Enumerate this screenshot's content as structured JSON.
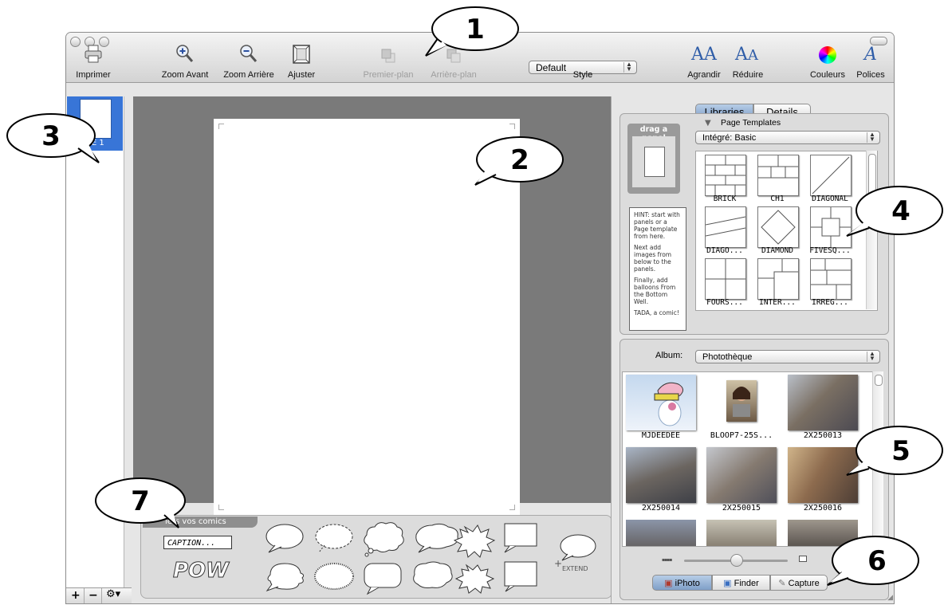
{
  "toolbar": {
    "print": "Imprimer",
    "zoom_in": "Zoom Avant",
    "zoom_out": "Zoom Arrière",
    "fit": "Ajuster",
    "bring_front": "Premier-plan",
    "send_back": "Arrière-plan",
    "style_value": "Default",
    "style_label": "Style",
    "bigger": "Agrandir",
    "smaller": "Réduire",
    "colors": "Couleurs",
    "fonts": "Polices"
  },
  "sidebar": {
    "page_label": "GE 1",
    "add": "+",
    "remove": "−"
  },
  "bottom_well": {
    "tab_label": "lers vos comics",
    "caption": "CAPTION...",
    "pow": "POW",
    "extend": "EXTEND"
  },
  "library": {
    "tab_libraries": "Libraries",
    "tab_details": "Details",
    "drag_panel": "drag a panel",
    "section_title": "Page Templates",
    "template_set": "Intégré: Basic",
    "hint": [
      "HINT: start with panels or a Page template from here.",
      "Next add images from below to the panels.",
      "Finally, add balloons From the Bottom Well.",
      "TADA, a comic!"
    ],
    "templates": [
      "BRICK",
      "CH1",
      "DIAGONAL",
      "DIAGO...",
      "DIAMOND",
      "FIVESQ...",
      "FOURS...",
      "INTER...",
      "IRREG..."
    ]
  },
  "media": {
    "album_label": "Album:",
    "album_value": "Photothèque",
    "photos": [
      "MJDEEDEE",
      "BLOOP7-25S...",
      "2X250013",
      "2X250014",
      "2X250015",
      "2X250016"
    ],
    "tabs": [
      "iPhoto",
      "Finder",
      "Capture"
    ]
  },
  "callouts": [
    "1",
    "2",
    "3",
    "4",
    "5",
    "6",
    "7"
  ],
  "colors": {
    "canvas": "#7a7a7a",
    "selection": "#3875d7",
    "segment_selected": "#9bb6da"
  }
}
